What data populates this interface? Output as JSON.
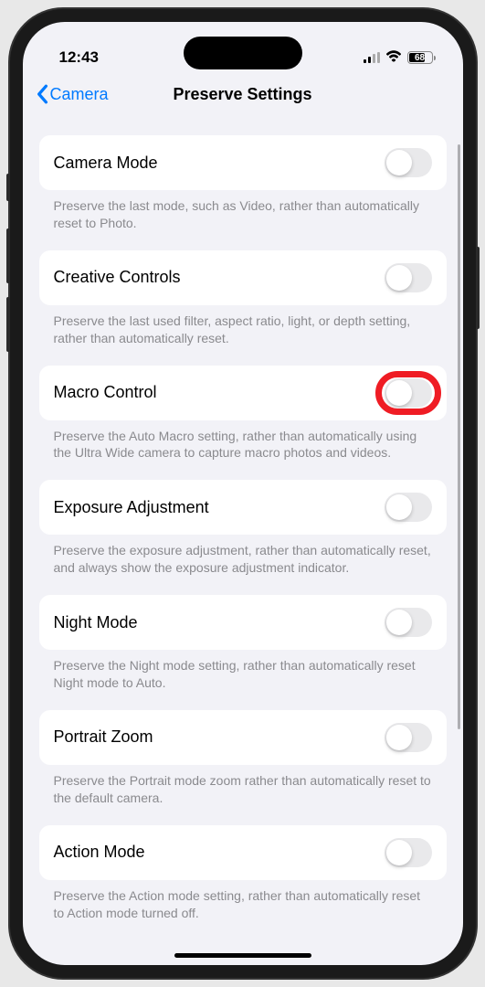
{
  "status": {
    "time": "12:43",
    "battery": "68"
  },
  "nav": {
    "back": "Camera",
    "title": "Preserve Settings"
  },
  "settings": [
    {
      "label": "Camera Mode",
      "desc": "Preserve the last mode, such as Video, rather than automatically reset to Photo.",
      "highlighted": false
    },
    {
      "label": "Creative Controls",
      "desc": "Preserve the last used filter, aspect ratio, light, or depth setting, rather than automatically reset.",
      "highlighted": false
    },
    {
      "label": "Macro Control",
      "desc": "Preserve the Auto Macro setting, rather than automatically using the Ultra Wide camera to capture macro photos and videos.",
      "highlighted": true
    },
    {
      "label": "Exposure Adjustment",
      "desc": "Preserve the exposure adjustment, rather than automatically reset, and always show the exposure adjustment indicator.",
      "highlighted": false
    },
    {
      "label": "Night Mode",
      "desc": "Preserve the Night mode setting, rather than automatically reset Night mode to Auto.",
      "highlighted": false
    },
    {
      "label": "Portrait Zoom",
      "desc": "Preserve the Portrait mode zoom rather than automatically reset to the default camera.",
      "highlighted": false
    },
    {
      "label": "Action Mode",
      "desc": "Preserve the Action mode setting, rather than automatically reset to Action mode turned off.",
      "highlighted": false
    }
  ]
}
